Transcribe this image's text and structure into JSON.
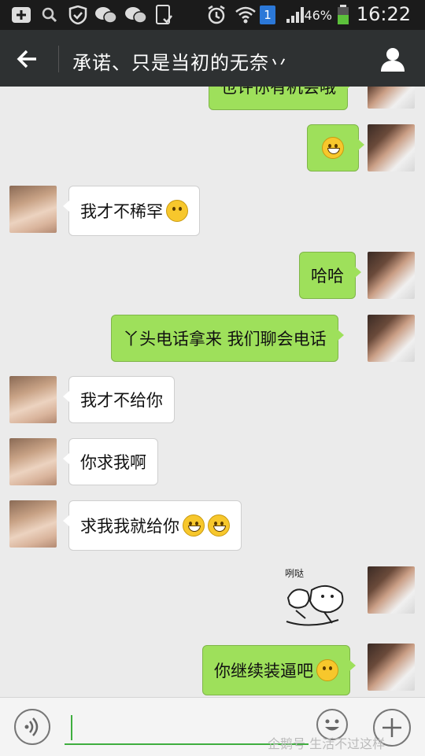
{
  "status_bar": {
    "battery_percent": "46%",
    "time": "16:22",
    "sim_badge": "1",
    "icons": [
      "add-box-icon",
      "search-icon",
      "shield-icon",
      "wechat-icon",
      "wechat-icon",
      "phone-check-icon",
      "alarm-icon",
      "wifi-icon",
      "sim-icon",
      "signal-icon",
      "battery-icon"
    ]
  },
  "header": {
    "title": "承诺、只是当初的无奈丷",
    "back_icon": "back-arrow-icon",
    "profile_icon": "profile-icon"
  },
  "messages": [
    {
      "sender": "me",
      "text": "也许你有机会哦",
      "partial": true
    },
    {
      "sender": "me",
      "text": "",
      "emoji": [
        "grin"
      ]
    },
    {
      "sender": "her",
      "text": "我才不稀罕",
      "emoji": [
        "thinking"
      ]
    },
    {
      "sender": "me",
      "text": "哈哈"
    },
    {
      "sender": "me",
      "text": "丫头电话拿来 我们聊会电话"
    },
    {
      "sender": "her",
      "text": "我才不给你"
    },
    {
      "sender": "her",
      "text": "你求我啊"
    },
    {
      "sender": "her",
      "text": "求我我就给你",
      "emoji": [
        "smug",
        "smug"
      ]
    },
    {
      "sender": "me",
      "sticker_text": "咧哒"
    },
    {
      "sender": "me",
      "text": "你继续装逼吧",
      "emoji": [
        "blush"
      ]
    }
  ],
  "input_bar": {
    "voice_icon": "voice-icon",
    "emoji_icon": "emoji-icon",
    "more_icon": "plus-icon",
    "value": ""
  },
  "watermark": "企鹅号 生活不过这样",
  "colors": {
    "header_bg": "#2e3132",
    "my_bubble": "#9ee05b",
    "her_bubble": "#ffffff",
    "chat_bg": "#ebebeb"
  }
}
